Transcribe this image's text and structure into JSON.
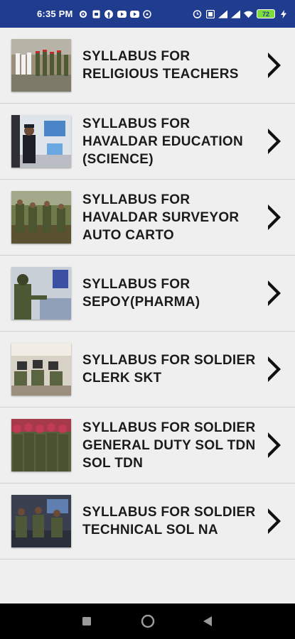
{
  "status_bar": {
    "time": "6:35 PM",
    "left_icons": [
      "gear-icon",
      "sim-icon",
      "facebook-icon",
      "youtube-icon",
      "youtube-icon",
      "whatsapp-icon"
    ],
    "right_icons": [
      "alarm-icon",
      "data-icon",
      "signal-icon",
      "signal-icon",
      "wifi-icon"
    ],
    "battery_level": "72"
  },
  "list": {
    "items": [
      {
        "label": "SYLLABUS FOR RELIGIOUS TEACHERS",
        "image": "religious-teachers-photo"
      },
      {
        "label": "SYLLABUS FOR HAVALDAR EDUCATION (SCIENCE)",
        "image": "havaldar-education-photo"
      },
      {
        "label": "SYLLABUS FOR HAVALDAR SURVEYOR AUTO CARTO",
        "image": "havaldar-surveyor-photo"
      },
      {
        "label": "SYLLABUS FOR SEPOY(PHARMA)",
        "image": "sepoy-pharma-photo"
      },
      {
        "label": "SYLLABUS FOR SOLDIER CLERK SKT",
        "image": "soldier-clerk-photo"
      },
      {
        "label": "SYLLABUS FOR SOLDIER GENERAL DUTY SOL TDN SOL TDN",
        "image": "soldier-general-duty-photo"
      },
      {
        "label": "SYLLABUS FOR SOLDIER TECHNICAL SOL NA",
        "image": "soldier-technical-photo"
      }
    ]
  },
  "nav_bar": {
    "buttons": [
      "recents-button",
      "home-button",
      "back-button"
    ]
  }
}
